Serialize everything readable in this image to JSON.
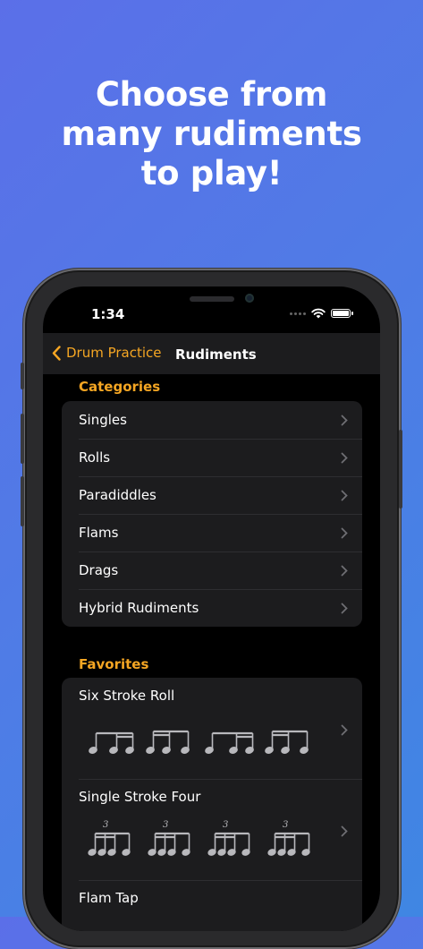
{
  "headline": {
    "line1": "Choose from",
    "line2": "many rudiments",
    "line3": "to play!"
  },
  "status_bar": {
    "time": "1:34"
  },
  "nav": {
    "back_label": "Drum Practice",
    "title": "Rudiments"
  },
  "categories": {
    "header": "Categories",
    "items": [
      {
        "label": "Singles"
      },
      {
        "label": "Rolls"
      },
      {
        "label": "Paradiddles"
      },
      {
        "label": "Flams"
      },
      {
        "label": "Drags"
      },
      {
        "label": "Hybrid Rudiments"
      }
    ]
  },
  "favorites": {
    "header": "Favorites",
    "items": [
      {
        "label": "Six Stroke Roll",
        "triplet_mark": ""
      },
      {
        "label": "Single Stroke Four",
        "triplet_mark": "3"
      },
      {
        "label": "Flam Tap",
        "triplet_mark": ""
      }
    ]
  },
  "colors": {
    "accent": "#f5a623",
    "background_gradient": [
      "#5b6fe8",
      "#3f86e3"
    ]
  },
  "icons": [
    "chevron-left-icon",
    "chevron-right-icon",
    "wifi-icon",
    "battery-icon",
    "signal-icon"
  ]
}
